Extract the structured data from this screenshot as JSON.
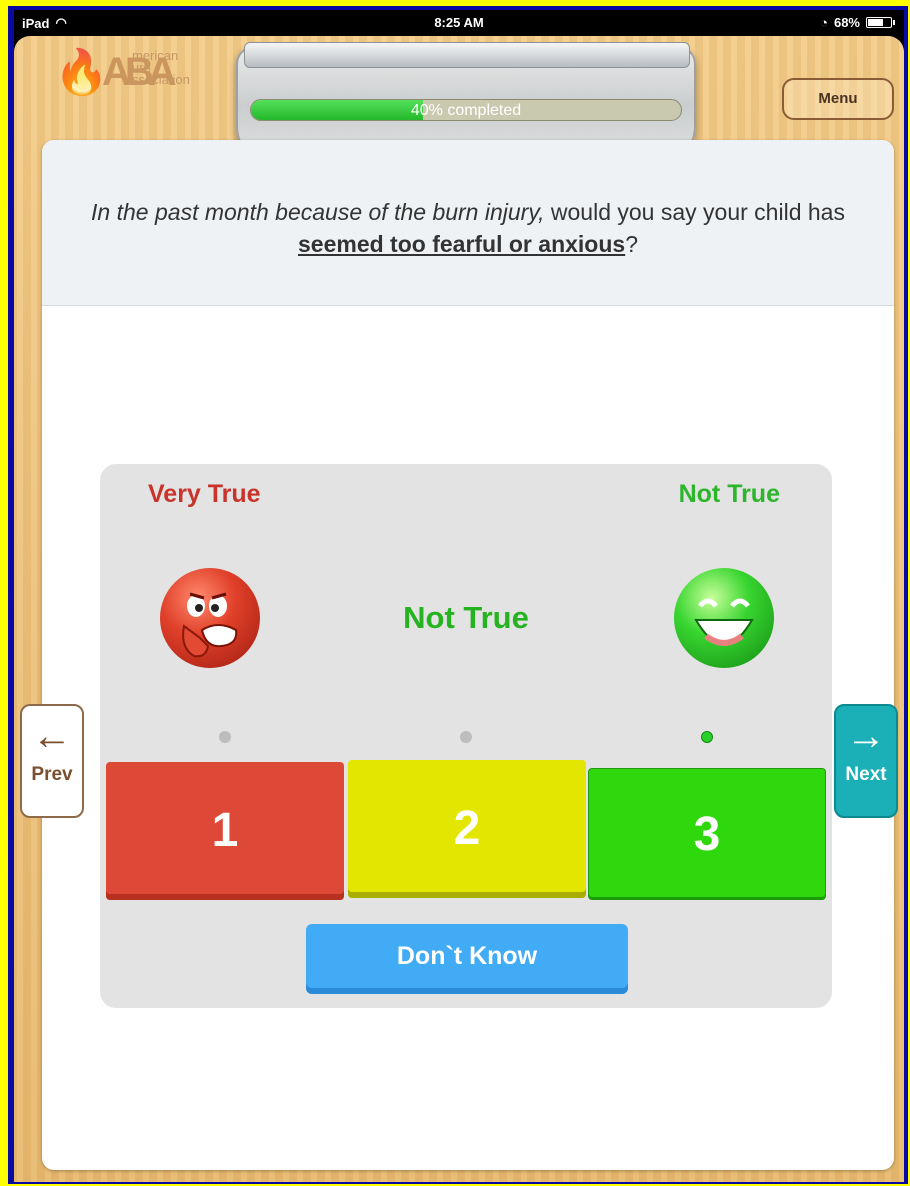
{
  "status_bar": {
    "device": "iPad",
    "time": "8:25 AM",
    "battery": "68%"
  },
  "header": {
    "logo": {
      "letters": "ABA",
      "line1": "merican",
      "line2": "urn",
      "line3": "ssociation"
    },
    "progress": {
      "percent": 40,
      "label": "40% completed"
    },
    "menu_label": "Menu"
  },
  "question": {
    "italic_part": "In the past month because of the burn injury,",
    "plain_part": " would you say your child has ",
    "bold_part": "seemed too fearful or anxious",
    "end": "?"
  },
  "scale": {
    "left_anchor": "Very True",
    "right_anchor": "Not True",
    "current_label": "Not True",
    "selected_option": 3,
    "options": [
      "1",
      "2",
      "3"
    ],
    "dont_know_label": "Don`t Know",
    "colors": {
      "option_1": "#de4836",
      "option_2": "#e2e600",
      "option_3": "#2ed80c",
      "dont_know": "#42abf5"
    }
  },
  "nav": {
    "prev_label": "Prev",
    "next_label": "Next",
    "prev_icon": "arrow-left-icon",
    "next_icon": "arrow-right-icon"
  }
}
